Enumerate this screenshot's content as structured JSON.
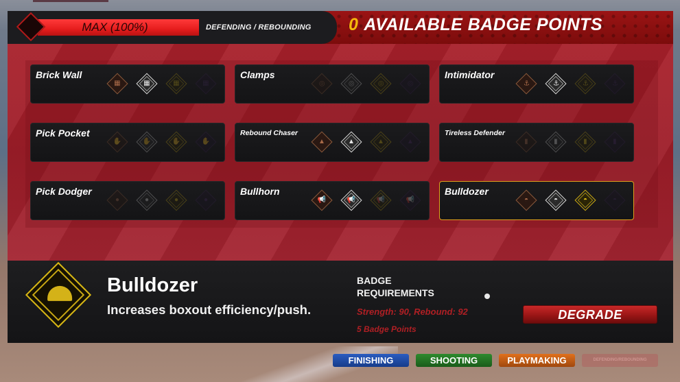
{
  "header": {
    "progress_label": "MAX (100%)",
    "progress_fraction": 1.0,
    "category": "DEFENDING / REBOUNDING",
    "available_points": "0",
    "available_points_label": "AVAILABLE BADGE POINTS"
  },
  "badges": [
    {
      "name": "Brick Wall",
      "icon": "brick-wall-icon",
      "glyph": "▦",
      "tiers": [
        "earned",
        "earned",
        "locked",
        "locked"
      ]
    },
    {
      "name": "Clamps",
      "icon": "clamps-icon",
      "glyph": "◎",
      "tiers": [
        "locked",
        "locked",
        "locked",
        "locked"
      ]
    },
    {
      "name": "Intimidator",
      "icon": "anchor-icon",
      "glyph": "⚓",
      "tiers": [
        "earned",
        "earned",
        "locked",
        "locked"
      ]
    },
    {
      "name": "Pick Pocket",
      "icon": "hand-icon",
      "glyph": "✋",
      "tiers": [
        "locked",
        "locked",
        "locked",
        "locked"
      ]
    },
    {
      "name": "Rebound Chaser",
      "icon": "rebound-icon",
      "glyph": "▲",
      "tiers": [
        "earned",
        "earned",
        "locked",
        "locked"
      ]
    },
    {
      "name": "Tireless Defender",
      "icon": "battery-icon",
      "glyph": "▮",
      "tiers": [
        "locked",
        "locked",
        "locked",
        "locked"
      ]
    },
    {
      "name": "Pick Dodger",
      "icon": "ball-icon",
      "glyph": "●",
      "tiers": [
        "locked",
        "locked",
        "locked",
        "locked"
      ]
    },
    {
      "name": "Bullhorn",
      "icon": "bullhorn-icon",
      "glyph": "📢",
      "tiers": [
        "earned",
        "earned",
        "locked",
        "locked"
      ]
    },
    {
      "name": "Bulldozer",
      "icon": "helmet-icon",
      "glyph": "◓",
      "tiers": [
        "earned",
        "earned",
        "earned",
        "locked"
      ],
      "selected": true
    }
  ],
  "detail": {
    "title": "Bulldozer",
    "description": "Increases boxout efficiency/push.",
    "requirements_title": "BADGE REQUIREMENTS",
    "requirements_stats": "Strength: 90, Rebound: 92",
    "requirements_points": "5 Badge Points",
    "action_button": "DEGRADE"
  },
  "categories": [
    {
      "label": "FINISHING",
      "color": "#2a5cc0"
    },
    {
      "label": "SHOOTING",
      "color": "#2e8a2e"
    },
    {
      "label": "PLAYMAKING",
      "color": "#e0701c"
    },
    {
      "label": "DEFENDING/REBOUNDING",
      "color": "#b45a5a",
      "active": true
    }
  ],
  "tier_colors": {
    "bronze": "#8a5a3c",
    "silver": "#d8d8d8",
    "gold": "#c9a814",
    "hof": "#3a2450"
  }
}
